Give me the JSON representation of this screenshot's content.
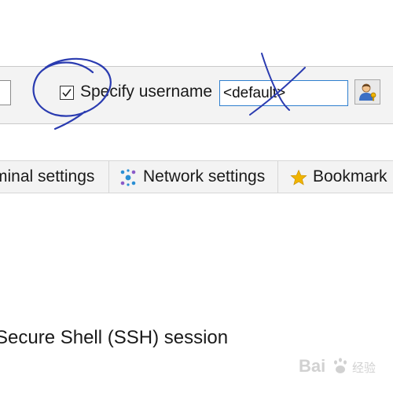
{
  "username_row": {
    "checkbox_checked": true,
    "checkbox_label": "Specify username",
    "username_value": "<default>"
  },
  "tabs": [
    {
      "label": "minal settings"
    },
    {
      "label": "Network settings",
      "icon": "network-icon"
    },
    {
      "label": "Bookmark",
      "icon": "star-icon"
    }
  ],
  "session": {
    "type_label": "Secure Shell (SSH) session"
  },
  "colors": {
    "annotation_ink": "#2a3bb0",
    "input_focus_border": "#2f7fcf",
    "star": "#f0b400",
    "network_dots": "#2a8fd4"
  },
  "watermark": {
    "text": "Bai",
    "text2": "经验"
  }
}
